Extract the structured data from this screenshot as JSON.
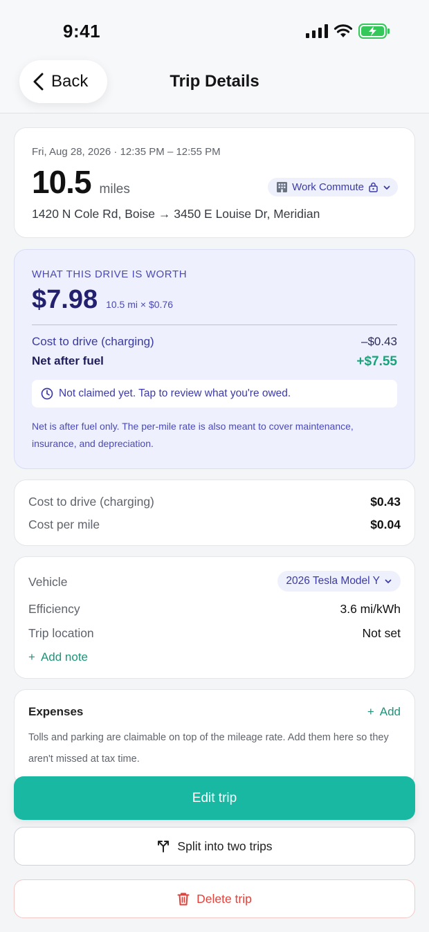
{
  "status_bar": {
    "time": "9:41"
  },
  "header": {
    "back_label": "Back",
    "title": "Trip Details"
  },
  "trip": {
    "date": "Fri, Aug 28, 2026 · 12:35 PM – 12:55 PM",
    "miles": "10.5",
    "miles_unit": "miles",
    "category": "Work Commute",
    "route": "1420 N Cole Rd, Boise → 3450 E Louise Dr, Meridian"
  },
  "worth": {
    "label": "WHAT THIS DRIVE IS WORTH",
    "amount": "$7.98",
    "calc": "10.5 mi × $0.76",
    "cost_label": "Cost to drive (charging)",
    "cost_value": "–$0.43",
    "net_label": "Net after fuel",
    "net_value": "+$7.55",
    "claim_text": "Not claimed yet. Tap to review what you're owed.",
    "note": "Net is after fuel only. The per-mile rate is also meant to cover maintenance, insurance, and depreciation."
  },
  "cost": {
    "rows": [
      {
        "label": "Cost to drive (charging)",
        "value": "$0.43"
      },
      {
        "label": "Cost per mile",
        "value": "$0.04"
      }
    ]
  },
  "vehicle": {
    "label": "Vehicle",
    "selected": "2026 Tesla Model Y",
    "efficiency_label": "Efficiency",
    "efficiency_value": "3.6 mi/kWh",
    "location_label": "Trip location",
    "location_value": "Not set",
    "add_note": "Add note"
  },
  "expenses": {
    "title": "Expenses",
    "add_label": "Add",
    "note": "Tolls and parking are claimable on top of the mileage rate. Add them here so they aren't missed at tax time."
  },
  "actions": {
    "edit": "Edit trip",
    "split": "Split into two trips",
    "delete": "Delete trip"
  },
  "colors": {
    "accent": "#18b8a2",
    "indigo": "#3b3aa8",
    "positive": "#1aa27a",
    "danger": "#e2423a"
  }
}
